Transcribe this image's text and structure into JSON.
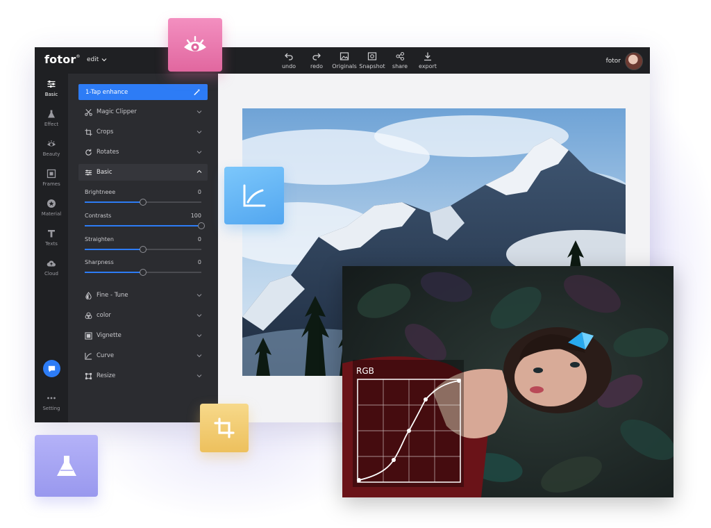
{
  "app": {
    "logo": "fotor",
    "logo_mark": "®",
    "edit_menu": "edit",
    "user_name": "fotor"
  },
  "toolbar": [
    {
      "label": "undo",
      "icon": "undo-icon"
    },
    {
      "label": "redo",
      "icon": "redo-icon"
    },
    {
      "label": "Originals",
      "icon": "image-icon"
    },
    {
      "label": "Snapshot",
      "icon": "snapshot-icon"
    },
    {
      "label": "share",
      "icon": "share-icon"
    },
    {
      "label": "export",
      "icon": "download-icon"
    }
  ],
  "leftnav": [
    {
      "label": "Basic",
      "icon": "sliders-icon",
      "active": true
    },
    {
      "label": "Effect",
      "icon": "flask-icon"
    },
    {
      "label": "Beauty",
      "icon": "eye-icon"
    },
    {
      "label": "Frames",
      "icon": "frame-icon"
    },
    {
      "label": "Material",
      "icon": "star-badge-icon"
    },
    {
      "label": "Texts",
      "icon": "text-icon"
    },
    {
      "label": "Cloud",
      "icon": "cloud-icon"
    },
    {
      "label": "Setting",
      "icon": "more-icon"
    }
  ],
  "panel": {
    "enhance": "1-Tap enhance",
    "sections_top": [
      "Magic Clipper",
      "Crops",
      "Rotates"
    ],
    "basic": "Basic",
    "sliders": [
      {
        "label": "Brightneee",
        "value": "0",
        "level": 0.5
      },
      {
        "label": "Contrasts",
        "value": "100",
        "level": 1.0
      },
      {
        "label": "Straighten",
        "value": "0",
        "level": 0.5
      },
      {
        "label": "Sharpness",
        "value": "0",
        "level": 0.5
      }
    ],
    "sections_bottom": [
      "Fine - Tune",
      "color",
      "Vignette",
      "Curve",
      "Resize"
    ]
  },
  "overlay": {
    "curve_title": "RGB"
  },
  "colors": {
    "accent": "#2d7cf6",
    "panel": "#2b2c30",
    "topbar": "#1f2023",
    "eye_tile": "#e76fa8",
    "curve_tile": "#5fb4f5",
    "crop_tile": "#f3cd6e",
    "flask_tile": "#a7a6f4"
  }
}
